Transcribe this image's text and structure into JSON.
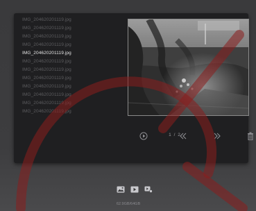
{
  "files": {
    "items": [
      "IMG_204620201119.jpg",
      "IMG_204620201119.jpg",
      "IMG_204620201119.jpg",
      "IMG_204620201119.jpg",
      "IMG_204620201119.jpg",
      "IMG_204620201119.jpg",
      "IMG_204620201119.jpg",
      "IMG_204620201119.jpg",
      "IMG_204620201119.jpg",
      "IMG_204620201119.jpg",
      "IMG_204620201119.jpg",
      "IMG_204620201119.jpg"
    ],
    "selected_index": 4
  },
  "pagination": {
    "text": "1 / 2"
  },
  "storage": {
    "text": "62.9GB/64GB"
  },
  "controls": {
    "icons": [
      "play-icon",
      "previous-icon",
      "next-icon",
      "delete-icon"
    ]
  },
  "bottom_bar": {
    "icons": [
      "photo-mode-icon",
      "video-mode-icon",
      "video-settings-icon"
    ]
  },
  "colors": {
    "panel": "#1f1f21",
    "text_dim": "#5d5d60",
    "text_active": "#e6e6e6",
    "watermark": "#8a1d1d"
  }
}
